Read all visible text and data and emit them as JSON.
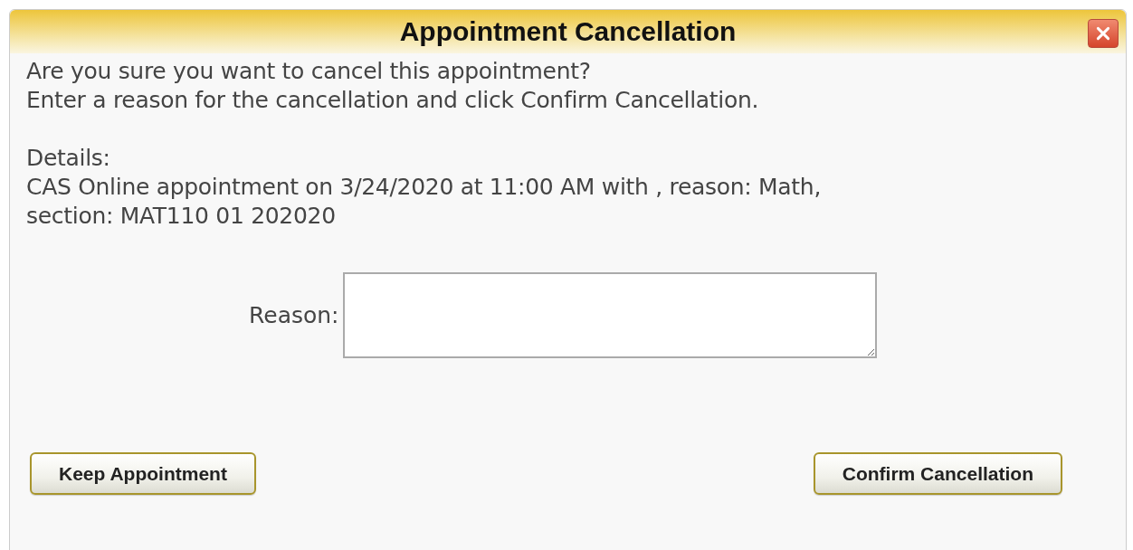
{
  "dialog": {
    "title": "Appointment Cancellation",
    "message": [
      "Are you sure you want to cancel this appointment?",
      "Enter a reason for the cancellation and click Confirm Cancellation."
    ],
    "details_label": "Details:",
    "details": [
      "CAS Online appointment on 3/24/2020 at 11:00 AM with , reason: Math,",
      "section: MAT110 01 202020"
    ],
    "reason": {
      "label": "Reason:"
    },
    "buttons": [
      "Keep Appointment",
      "Confirm Cancellation"
    ]
  }
}
